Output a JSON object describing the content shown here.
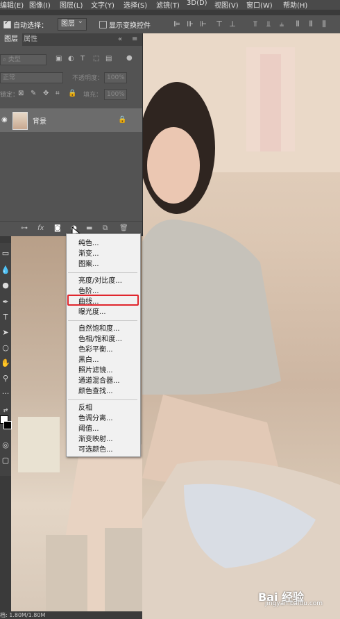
{
  "menubar": [
    "编辑(E)",
    "图像(I)",
    "图层(L)",
    "文字(Y)",
    "选择(S)",
    "滤镜(T)",
    "3D(D)",
    "视图(V)",
    "窗口(W)",
    "帮助(H)"
  ],
  "options": {
    "auto_select_label": "自动选择：",
    "auto_select_value": "图层",
    "show_transform_label": "显示变换控件"
  },
  "panel": {
    "tabs": [
      "图层",
      "属性"
    ],
    "filter_placeholder": "类型",
    "blend_mode": "正常",
    "opacity_label": "不透明度：",
    "opacity_value": "100%",
    "lock_label": "锁定：",
    "fill_label": "填充：",
    "fill_value": "100%",
    "layer_name": "背景"
  },
  "menu": {
    "group1": [
      "纯色...",
      "渐变...",
      "图案..."
    ],
    "group2": [
      "亮度/对比度...",
      "色阶...",
      "曲线...",
      "曝光度..."
    ],
    "group3": [
      "自然饱和度...",
      "色相/饱和度...",
      "色彩平衡...",
      "黑白...",
      "照片滤镜...",
      "通道混合器...",
      "颜色查找..."
    ],
    "group4": [
      "反相",
      "色调分离...",
      "阈值...",
      "渐变映射...",
      "可选颜色..."
    ]
  },
  "status": "档: 1.80M/1.80M",
  "watermark": {
    "logo": "Bai  经验",
    "url": "jingyan.baidu.com"
  },
  "colors": {
    "highlight": "#e0262d"
  }
}
